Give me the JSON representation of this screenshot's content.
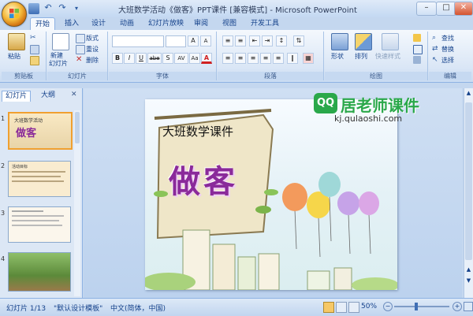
{
  "window": {
    "title": "大班数学活动《做客》PPT课件 [兼容模式] - Microsoft PowerPoint",
    "minimize_label": "–",
    "maximize_label": "□",
    "close_label": "✕"
  },
  "ribbon_tabs": [
    {
      "label": "开始",
      "active": true
    },
    {
      "label": "插入"
    },
    {
      "label": "设计"
    },
    {
      "label": "动画"
    },
    {
      "label": "幻灯片放映"
    },
    {
      "label": "审阅"
    },
    {
      "label": "视图"
    },
    {
      "label": "开发工具"
    }
  ],
  "groups": {
    "clipboard": {
      "label": "剪贴板",
      "paste": "粘贴"
    },
    "slides": {
      "label": "幻灯片",
      "new_slide": "新建",
      "new_slide2": "幻灯片",
      "layout": "版式",
      "reset": "重设",
      "delete": "删除"
    },
    "font": {
      "label": "字体",
      "bold": "B",
      "italic": "I",
      "underline": "U",
      "strike": "abe",
      "shadow": "S",
      "spacing": "AV",
      "case": "Aa",
      "color": "A"
    },
    "paragraph": {
      "label": "段落"
    },
    "drawing": {
      "label": "绘图",
      "shapes": "形状",
      "arrange": "排列",
      "quick_styles": "快速样式"
    },
    "editing": {
      "label": "编辑",
      "find": "查找",
      "replace": "替换",
      "select": "选择"
    }
  },
  "left_pane": {
    "tab_slides": "幻灯片",
    "tab_outline": "大纲",
    "close_label": "✕",
    "thumbnails": [
      "1",
      "2",
      "3",
      "4"
    ],
    "thumb1_title": "大班数学活动",
    "thumb1_word": "做客",
    "thumb2_title": "活动目标"
  },
  "slide": {
    "heading": "大班数学课件",
    "main_word": "做客",
    "watermark_logo": "QQ",
    "watermark_title": "居老师课件",
    "watermark_url": "kj.qulaoshi.com"
  },
  "status": {
    "slide_position": "幻灯片 1/13",
    "theme": "\"默认设计模板\"",
    "language": "中文(简体，中国)",
    "zoom": "50%"
  },
  "colors": {
    "ribbon_blue": "#c4d7ef",
    "accent_orange": "#f4b93a",
    "main_word_purple": "#8a2a9a",
    "watermark_green": "#2aa84a"
  }
}
